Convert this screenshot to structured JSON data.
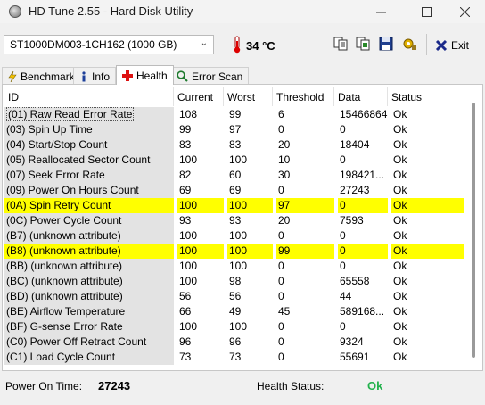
{
  "window": {
    "title": "HD Tune 2.55 - Hard Disk Utility"
  },
  "toolbar": {
    "drive": "ST1000DM003-1CH162 (1000 GB)",
    "temperature": "34 °C",
    "exit_label": "Exit"
  },
  "tabs": [
    {
      "label": "Benchmark",
      "icon": "benchmark-icon"
    },
    {
      "label": "Info",
      "icon": "info-icon"
    },
    {
      "label": "Health",
      "icon": "health-icon",
      "active": true
    },
    {
      "label": "Error Scan",
      "icon": "error-scan-icon"
    }
  ],
  "table": {
    "headers": [
      "ID",
      "Current",
      "Worst",
      "Threshold",
      "Data",
      "Status"
    ],
    "rows": [
      {
        "id": "(01) Raw Read Error Rate",
        "current": "108",
        "worst": "99",
        "threshold": "6",
        "data": "15466864",
        "status": "Ok",
        "highlight": false,
        "selected": true
      },
      {
        "id": "(03) Spin Up Time",
        "current": "99",
        "worst": "97",
        "threshold": "0",
        "data": "0",
        "status": "Ok",
        "highlight": false
      },
      {
        "id": "(04) Start/Stop Count",
        "current": "83",
        "worst": "83",
        "threshold": "20",
        "data": "18404",
        "status": "Ok",
        "highlight": false
      },
      {
        "id": "(05) Reallocated Sector Count",
        "current": "100",
        "worst": "100",
        "threshold": "10",
        "data": "0",
        "status": "Ok",
        "highlight": false
      },
      {
        "id": "(07) Seek Error Rate",
        "current": "82",
        "worst": "60",
        "threshold": "30",
        "data": "198421...",
        "status": "Ok",
        "highlight": false
      },
      {
        "id": "(09) Power On Hours Count",
        "current": "69",
        "worst": "69",
        "threshold": "0",
        "data": "27243",
        "status": "Ok",
        "highlight": false
      },
      {
        "id": "(0A) Spin Retry Count",
        "current": "100",
        "worst": "100",
        "threshold": "97",
        "data": "0",
        "status": "Ok",
        "highlight": true
      },
      {
        "id": "(0C) Power Cycle Count",
        "current": "93",
        "worst": "93",
        "threshold": "20",
        "data": "7593",
        "status": "Ok",
        "highlight": false
      },
      {
        "id": "(B7) (unknown attribute)",
        "current": "100",
        "worst": "100",
        "threshold": "0",
        "data": "0",
        "status": "Ok",
        "highlight": false
      },
      {
        "id": "(B8) (unknown attribute)",
        "current": "100",
        "worst": "100",
        "threshold": "99",
        "data": "0",
        "status": "Ok",
        "highlight": true
      },
      {
        "id": "(BB) (unknown attribute)",
        "current": "100",
        "worst": "100",
        "threshold": "0",
        "data": "0",
        "status": "Ok",
        "highlight": false
      },
      {
        "id": "(BC) (unknown attribute)",
        "current": "100",
        "worst": "98",
        "threshold": "0",
        "data": "65558",
        "status": "Ok",
        "highlight": false
      },
      {
        "id": "(BD) (unknown attribute)",
        "current": "56",
        "worst": "56",
        "threshold": "0",
        "data": "44",
        "status": "Ok",
        "highlight": false
      },
      {
        "id": "(BE) Airflow Temperature",
        "current": "66",
        "worst": "49",
        "threshold": "45",
        "data": "589168...",
        "status": "Ok",
        "highlight": false
      },
      {
        "id": "(BF) G-sense Error Rate",
        "current": "100",
        "worst": "100",
        "threshold": "0",
        "data": "0",
        "status": "Ok",
        "highlight": false
      },
      {
        "id": "(C0) Power Off Retract Count",
        "current": "96",
        "worst": "96",
        "threshold": "0",
        "data": "9324",
        "status": "Ok",
        "highlight": false
      },
      {
        "id": "(C1) Load Cycle Count",
        "current": "73",
        "worst": "73",
        "threshold": "0",
        "data": "55691",
        "status": "Ok",
        "highlight": false
      }
    ]
  },
  "status": {
    "power_on_label": "Power On Time:",
    "power_on_value": "27243",
    "health_label": "Health Status:",
    "health_value": "Ok"
  },
  "colors": {
    "highlight": "#ffff00",
    "health_ok": "#22b14c",
    "id_column_bg": "#e3e3e3"
  }
}
